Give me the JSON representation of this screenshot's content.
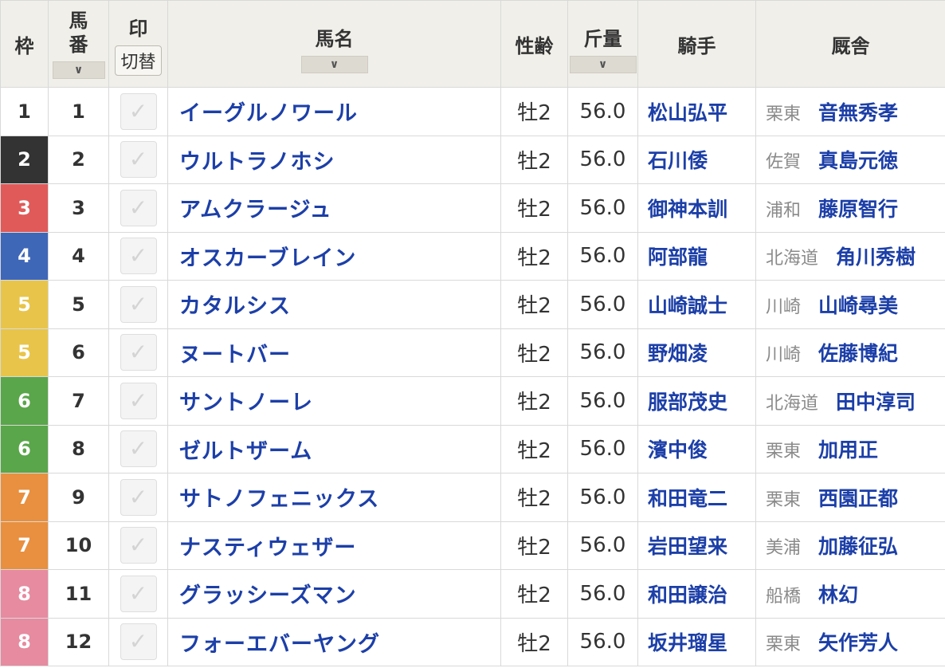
{
  "header": {
    "waku": "枠",
    "umaban": [
      "馬",
      "番"
    ],
    "mark": "印",
    "mark_toggle": "切替",
    "name": "馬名",
    "sex_age": "性齢",
    "weight": "斤量",
    "jockey": "騎手",
    "stable": "厩舎",
    "sort_icon": "∨"
  },
  "colors": {
    "waku": {
      "1": "#ffffff",
      "2": "#333333",
      "3": "#e05a5a",
      "4": "#3f67b8",
      "5": "#e8c54a",
      "6": "#5aa64a",
      "7": "#e8903f",
      "8": "#e68ba0"
    },
    "link": "#1c3fa8"
  },
  "rows": [
    {
      "waku": "1",
      "ban": "1",
      "name": "イーグルノワール",
      "sex": "牡2",
      "kin": "56.0",
      "jockey": "松山弘平",
      "region": "栗東",
      "trainer": "音無秀孝"
    },
    {
      "waku": "2",
      "ban": "2",
      "name": "ウルトラノホシ",
      "sex": "牡2",
      "kin": "56.0",
      "jockey": "石川倭",
      "region": "佐賀",
      "trainer": "真島元徳"
    },
    {
      "waku": "3",
      "ban": "3",
      "name": "アムクラージュ",
      "sex": "牡2",
      "kin": "56.0",
      "jockey": "御神本訓",
      "region": "浦和",
      "trainer": "藤原智行"
    },
    {
      "waku": "4",
      "ban": "4",
      "name": "オスカーブレイン",
      "sex": "牡2",
      "kin": "56.0",
      "jockey": "阿部龍",
      "region": "北海道",
      "trainer": "角川秀樹"
    },
    {
      "waku": "5",
      "ban": "5",
      "name": "カタルシス",
      "sex": "牡2",
      "kin": "56.0",
      "jockey": "山崎誠士",
      "region": "川崎",
      "trainer": "山崎尋美"
    },
    {
      "waku": "5",
      "ban": "6",
      "name": "ヌートバー",
      "sex": "牡2",
      "kin": "56.0",
      "jockey": "野畑凌",
      "region": "川崎",
      "trainer": "佐藤博紀"
    },
    {
      "waku": "6",
      "ban": "7",
      "name": "サントノーレ",
      "sex": "牡2",
      "kin": "56.0",
      "jockey": "服部茂史",
      "region": "北海道",
      "trainer": "田中淳司"
    },
    {
      "waku": "6",
      "ban": "8",
      "name": "ゼルトザーム",
      "sex": "牡2",
      "kin": "56.0",
      "jockey": "濱中俊",
      "region": "栗東",
      "trainer": "加用正"
    },
    {
      "waku": "7",
      "ban": "9",
      "name": "サトノフェニックス",
      "sex": "牡2",
      "kin": "56.0",
      "jockey": "和田竜二",
      "region": "栗東",
      "trainer": "西園正都"
    },
    {
      "waku": "7",
      "ban": "10",
      "name": "ナスティウェザー",
      "sex": "牡2",
      "kin": "56.0",
      "jockey": "岩田望来",
      "region": "美浦",
      "trainer": "加藤征弘"
    },
    {
      "waku": "8",
      "ban": "11",
      "name": "グラッシーズマン",
      "sex": "牡2",
      "kin": "56.0",
      "jockey": "和田譲治",
      "region": "船橋",
      "trainer": "林幻"
    },
    {
      "waku": "8",
      "ban": "12",
      "name": "フォーエバーヤング",
      "sex": "牡2",
      "kin": "56.0",
      "jockey": "坂井瑠星",
      "region": "栗東",
      "trainer": "矢作芳人"
    }
  ]
}
